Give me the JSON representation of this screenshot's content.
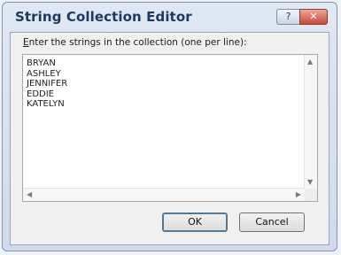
{
  "window": {
    "title": "String Collection Editor",
    "help_icon": "question-mark-icon",
    "close_icon": "close-icon"
  },
  "prompt": {
    "accel": "E",
    "rest": "nter the strings in the collection (one per line):"
  },
  "editor": {
    "lines": [
      "BRYAN",
      "ASHLEY",
      "JENNIFER",
      "EDDIE",
      "KATELYN"
    ]
  },
  "buttons": {
    "ok": "OK",
    "cancel": "Cancel"
  }
}
